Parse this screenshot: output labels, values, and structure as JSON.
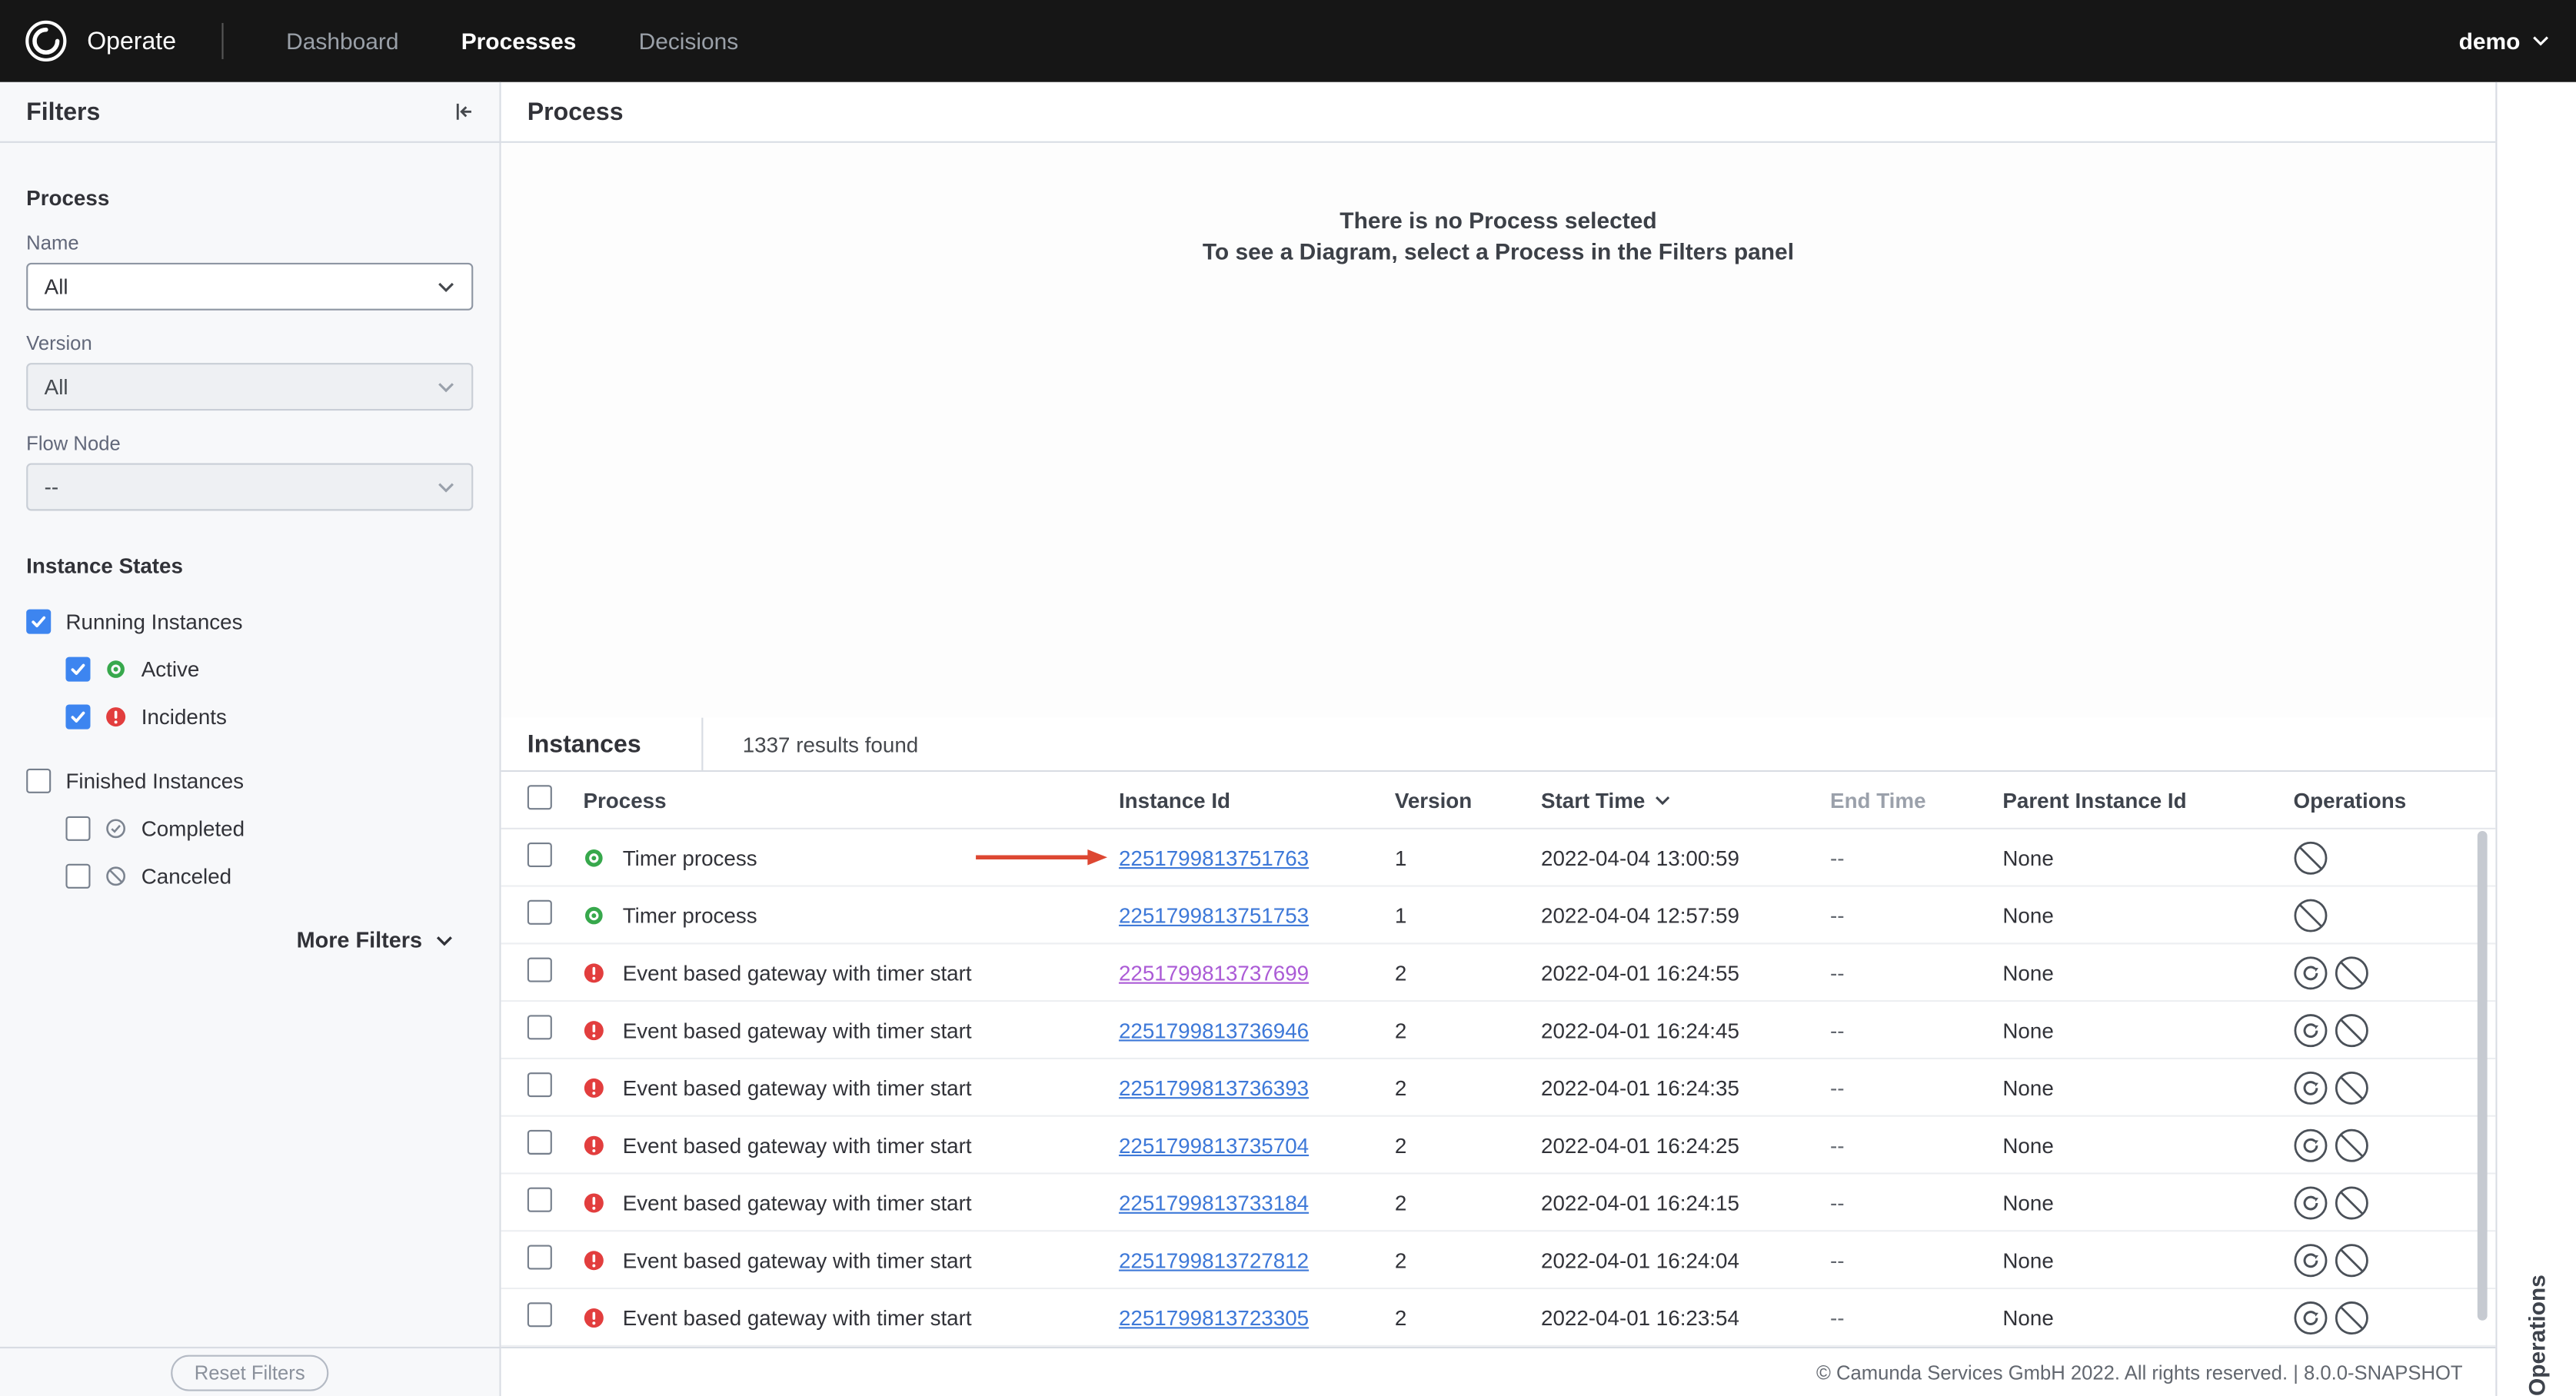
{
  "header": {
    "brand": "Operate",
    "nav": [
      {
        "label": "Dashboard",
        "active": false
      },
      {
        "label": "Processes",
        "active": true
      },
      {
        "label": "Decisions",
        "active": false
      }
    ],
    "user": "demo"
  },
  "filters": {
    "title": "Filters",
    "process_label": "Process",
    "fields": [
      {
        "label": "Name",
        "value": "All",
        "enabled": true
      },
      {
        "label": "Version",
        "value": "All",
        "enabled": false
      },
      {
        "label": "Flow Node",
        "value": "--",
        "enabled": false
      }
    ],
    "instance_states_label": "Instance States",
    "checkboxes": [
      {
        "label": "Running Instances",
        "checked": true,
        "indent": 0,
        "icon": null,
        "gap_before": false
      },
      {
        "label": "Active",
        "checked": true,
        "indent": 1,
        "icon": "active",
        "gap_before": false
      },
      {
        "label": "Incidents",
        "checked": true,
        "indent": 1,
        "icon": "incident",
        "gap_before": false
      },
      {
        "label": "Finished Instances",
        "checked": false,
        "indent": 0,
        "icon": null,
        "gap_before": true
      },
      {
        "label": "Completed",
        "checked": false,
        "indent": 1,
        "icon": "completed",
        "gap_before": false
      },
      {
        "label": "Canceled",
        "checked": false,
        "indent": 1,
        "icon": "canceled",
        "gap_before": false
      }
    ],
    "more_filters_label": "More Filters",
    "reset_label": "Reset Filters"
  },
  "process_panel": {
    "title": "Process",
    "empty_line1": "There is no Process selected",
    "empty_line2": "To see a Diagram, select a Process in the Filters panel"
  },
  "instances": {
    "title": "Instances",
    "results_text": "1337 results found",
    "columns": [
      {
        "label": "Process"
      },
      {
        "label": "Instance Id"
      },
      {
        "label": "Version"
      },
      {
        "label": "Start Time",
        "sorted": "desc"
      },
      {
        "label": "End Time",
        "muted": true
      },
      {
        "label": "Parent Instance Id"
      },
      {
        "label": "Operations"
      }
    ],
    "rows": [
      {
        "state": "active",
        "process": "Timer process",
        "id": "2251799813751763",
        "version": "1",
        "start_time": "2022-04-04 13:00:59",
        "end_time": "--",
        "parent": "None",
        "operations": [
          "cancel"
        ],
        "visited": false,
        "annotated": true
      },
      {
        "state": "active",
        "process": "Timer process",
        "id": "2251799813751753",
        "version": "1",
        "start_time": "2022-04-04 12:57:59",
        "end_time": "--",
        "parent": "None",
        "operations": [
          "cancel"
        ],
        "visited": false,
        "annotated": false
      },
      {
        "state": "incident",
        "process": "Event based gateway with timer start",
        "id": "2251799813737699",
        "version": "2",
        "start_time": "2022-04-01 16:24:55",
        "end_time": "--",
        "parent": "None",
        "operations": [
          "retry",
          "cancel"
        ],
        "visited": true,
        "annotated": false
      },
      {
        "state": "incident",
        "process": "Event based gateway with timer start",
        "id": "2251799813736946",
        "version": "2",
        "start_time": "2022-04-01 16:24:45",
        "end_time": "--",
        "parent": "None",
        "operations": [
          "retry",
          "cancel"
        ],
        "visited": false,
        "annotated": false
      },
      {
        "state": "incident",
        "process": "Event based gateway with timer start",
        "id": "2251799813736393",
        "version": "2",
        "start_time": "2022-04-01 16:24:35",
        "end_time": "--",
        "parent": "None",
        "operations": [
          "retry",
          "cancel"
        ],
        "visited": false,
        "annotated": false
      },
      {
        "state": "incident",
        "process": "Event based gateway with timer start",
        "id": "2251799813735704",
        "version": "2",
        "start_time": "2022-04-01 16:24:25",
        "end_time": "--",
        "parent": "None",
        "operations": [
          "retry",
          "cancel"
        ],
        "visited": false,
        "annotated": false
      },
      {
        "state": "incident",
        "process": "Event based gateway with timer start",
        "id": "2251799813733184",
        "version": "2",
        "start_time": "2022-04-01 16:24:15",
        "end_time": "--",
        "parent": "None",
        "operations": [
          "retry",
          "cancel"
        ],
        "visited": false,
        "annotated": false
      },
      {
        "state": "incident",
        "process": "Event based gateway with timer start",
        "id": "2251799813727812",
        "version": "2",
        "start_time": "2022-04-01 16:24:04",
        "end_time": "--",
        "parent": "None",
        "operations": [
          "retry",
          "cancel"
        ],
        "visited": false,
        "annotated": false
      },
      {
        "state": "incident",
        "process": "Event based gateway with timer start",
        "id": "2251799813723305",
        "version": "2",
        "start_time": "2022-04-01 16:23:54",
        "end_time": "--",
        "parent": "None",
        "operations": [
          "retry",
          "cancel"
        ],
        "visited": false,
        "annotated": false
      }
    ]
  },
  "operations_panel": {
    "title": "Operations"
  },
  "footer": {
    "copyright": "© Camunda Services GmbH 2022. All rights reserved. | 8.0.0-SNAPSHOT"
  },
  "colors": {
    "accent_blue": "#3d85f0",
    "link_blue": "#3d78d8",
    "link_visited": "#ab5bd6",
    "active_green": "#37a84c",
    "incident_red": "#e23e3e",
    "annotation_red": "#dd4732",
    "header_bg": "#161616"
  }
}
